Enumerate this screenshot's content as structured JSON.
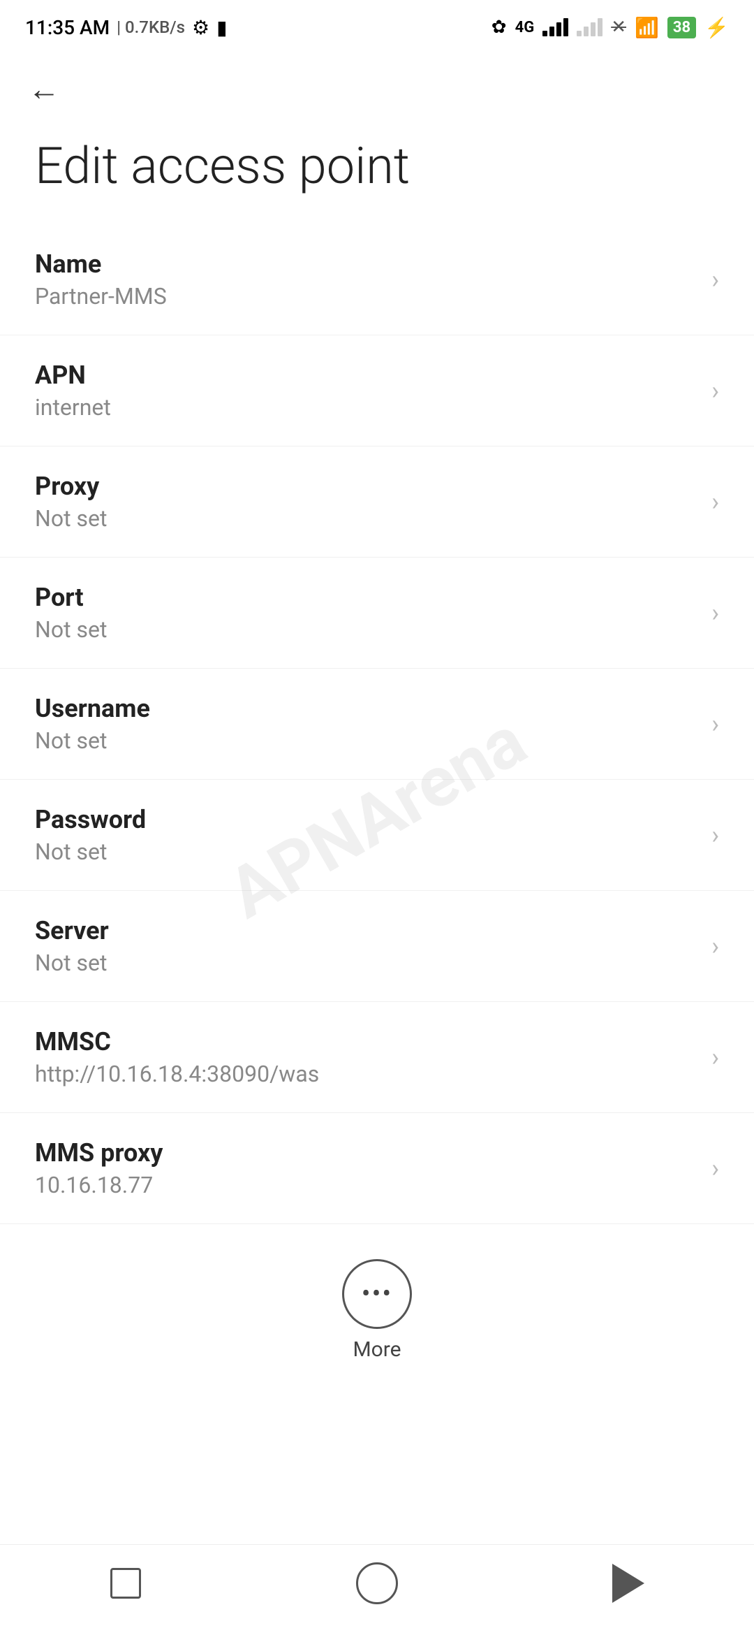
{
  "statusBar": {
    "time": "11:35 AM",
    "speed": "0.7KB/s",
    "battery": "38"
  },
  "header": {
    "back_label": "←",
    "title": "Edit access point"
  },
  "settings": {
    "items": [
      {
        "label": "Name",
        "value": "Partner-MMS"
      },
      {
        "label": "APN",
        "value": "internet"
      },
      {
        "label": "Proxy",
        "value": "Not set"
      },
      {
        "label": "Port",
        "value": "Not set"
      },
      {
        "label": "Username",
        "value": "Not set"
      },
      {
        "label": "Password",
        "value": "Not set"
      },
      {
        "label": "Server",
        "value": "Not set"
      },
      {
        "label": "MMSC",
        "value": "http://10.16.18.4:38090/was"
      },
      {
        "label": "MMS proxy",
        "value": "10.16.18.77"
      }
    ]
  },
  "more": {
    "label": "More"
  },
  "watermark": "APNArena"
}
